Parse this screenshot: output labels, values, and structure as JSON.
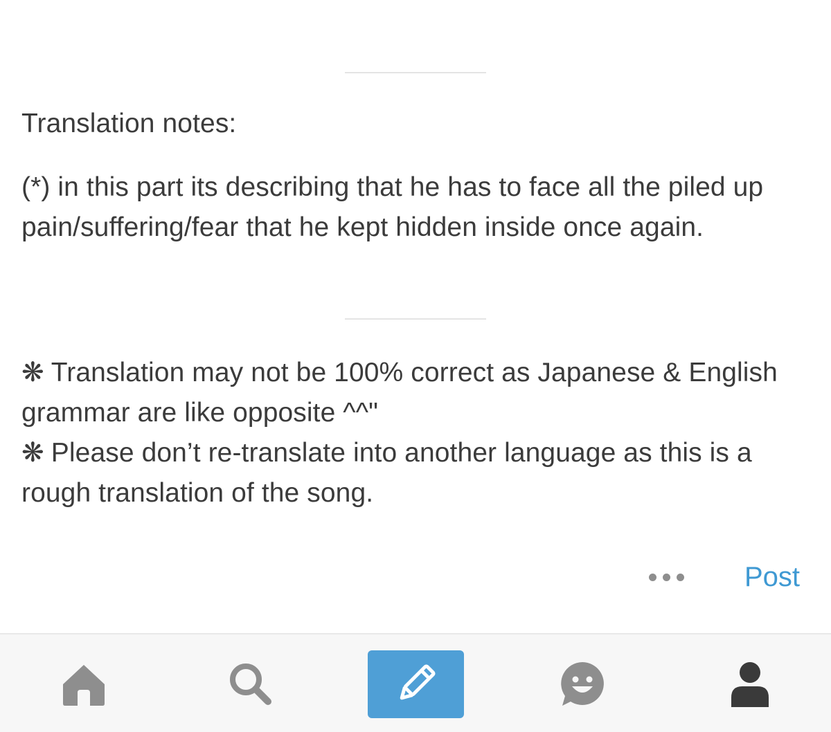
{
  "post": {
    "notes_heading": "Translation notes:",
    "notes_body": "(*) in this part its describing that he has to face all the piled up pain/suffering/fear that he kept hidden inside once again.",
    "disclaimer_1": "Translation may not be 100% correct as Japanese & English grammar are like opposite ^^\"",
    "disclaimer_2": "Please don’t re-translate into another language as this is a rough translation of the song.",
    "asterisk": "❋"
  },
  "actions": {
    "post_label": "Post",
    "more_icon": "more-dots-icon"
  },
  "tab_bar": {
    "items": [
      {
        "name": "home",
        "icon": "home-icon",
        "active": false
      },
      {
        "name": "search",
        "icon": "search-icon",
        "active": false
      },
      {
        "name": "compose",
        "icon": "pencil-icon",
        "active": true
      },
      {
        "name": "notifications",
        "icon": "smiley-chat-icon",
        "active": false
      },
      {
        "name": "profile",
        "icon": "person-icon",
        "active": false
      }
    ]
  },
  "colors": {
    "accent": "#4f9fd6",
    "post_link": "#3f99d3",
    "icon_gray": "#8e8e8e",
    "icon_dark": "#3a3a3a",
    "text": "#3b3b3b"
  }
}
